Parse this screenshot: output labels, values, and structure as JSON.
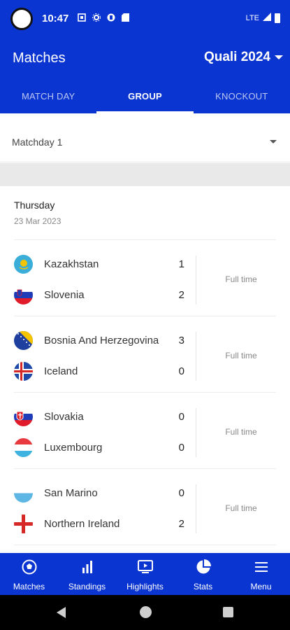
{
  "status_bar": {
    "time": "10:47",
    "network": "LTE",
    "icons": [
      "nfc-icon",
      "settings-icon",
      "app-icon",
      "sdcard-icon"
    ]
  },
  "header": {
    "title": "Matches",
    "season_selector": "Quali 2024"
  },
  "tabs": [
    {
      "label": "MATCH DAY",
      "active": false
    },
    {
      "label": "GROUP",
      "active": true
    },
    {
      "label": "KNOCKOUT",
      "active": false
    }
  ],
  "matchday": {
    "selected": "Matchday 1"
  },
  "day_section": {
    "day": "Thursday",
    "date": "23 Mar 2023"
  },
  "matches": [
    {
      "home": {
        "name": "Kazakhstan",
        "score": "1",
        "flag": "kazakhstan-flag-icon"
      },
      "away": {
        "name": "Slovenia",
        "score": "2",
        "flag": "slovenia-flag-icon"
      },
      "status": "Full time"
    },
    {
      "home": {
        "name": "Bosnia And Herzegovina",
        "score": "3",
        "flag": "bosnia-flag-icon"
      },
      "away": {
        "name": "Iceland",
        "score": "0",
        "flag": "iceland-flag-icon"
      },
      "status": "Full time"
    },
    {
      "home": {
        "name": "Slovakia",
        "score": "0",
        "flag": "slovakia-flag-icon"
      },
      "away": {
        "name": "Luxembourg",
        "score": "0",
        "flag": "luxembourg-flag-icon"
      },
      "status": "Full time"
    },
    {
      "home": {
        "name": "San Marino",
        "score": "0",
        "flag": "san-marino-flag-icon"
      },
      "away": {
        "name": "Northern Ireland",
        "score": "2",
        "flag": "northern-ireland-flag-icon"
      },
      "status": "Full time"
    }
  ],
  "bottom_nav": [
    {
      "label": "Matches",
      "icon": "soccer-ball-icon"
    },
    {
      "label": "Standings",
      "icon": "bar-chart-icon"
    },
    {
      "label": "Highlights",
      "icon": "play-screen-icon"
    },
    {
      "label": "Stats",
      "icon": "pie-chart-icon"
    },
    {
      "label": "Menu",
      "icon": "hamburger-icon"
    }
  ],
  "colors": {
    "primary": "#0b35d1",
    "text": "#333333",
    "muted": "#888888"
  }
}
